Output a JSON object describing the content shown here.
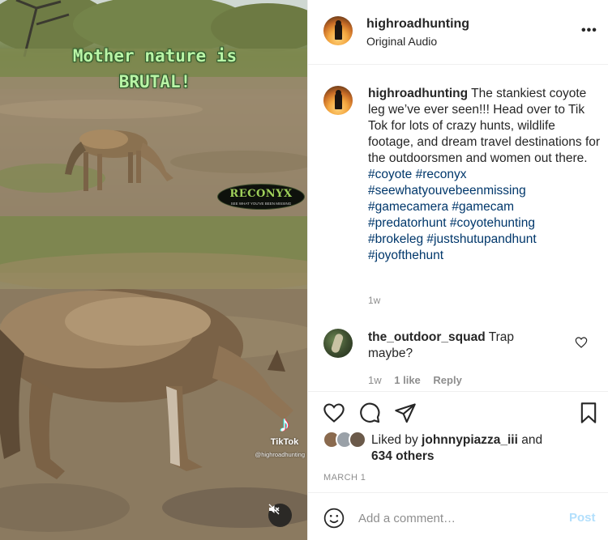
{
  "media": {
    "overlay_line1": "Mother nature is",
    "overlay_line2": "BRUTAL!",
    "camera_brand": "RECONYX",
    "camera_tagline": "SEE WHAT YOU'VE BEEN MISSING",
    "tiktok_label": "TikTok",
    "tiktok_handle": "@highroadhunting",
    "mute_icon": "speaker-muted-icon"
  },
  "header": {
    "username": "highroadhunting",
    "subtitle": "Original Audio",
    "more_icon": "more-options-icon",
    "more_label": "•••"
  },
  "caption": {
    "username": "highroadhunting",
    "text": "The stankiest coyote leg we’ve ever seen!!! Head over to Tik Tok for lots of crazy hunts, wildlife footage, and dream travel destinations for the outdoorsmen and women out there.",
    "hashtags": [
      "#coyote",
      "#reconyx",
      "#seewhatyouvebeenmissing",
      "#gamecamera",
      "#gamecam",
      "#predatorhunt",
      "#coyotehunting",
      "#brokeleg",
      "#justshutupandhunt",
      "#joyofthehunt"
    ],
    "time": "1w"
  },
  "comment": {
    "username": "the_outdoor_squad",
    "text": "Trap maybe?",
    "time": "1w",
    "likes": "1 like",
    "reply": "Reply",
    "heart_icon": "heart-outline-icon"
  },
  "actions": {
    "icons": [
      "heart-icon",
      "comment-icon",
      "share-icon",
      "bookmark-icon"
    ],
    "liked_by_prefix": "Liked by",
    "liked_by_user": "johnnypiazza_iii",
    "liked_by_and": "and",
    "liked_by_others": "634 others",
    "date": "MARCH 1"
  },
  "add_comment": {
    "placeholder": "Add a comment…",
    "post_label": "Post",
    "emoji_icon": "emoji-icon"
  },
  "colors": {
    "hashtag": "#00376b",
    "muted_text": "#8e8e8e",
    "post_disabled": "#b2dffc",
    "overlay_text": "#b9f4a6",
    "divider": "#efefef"
  }
}
